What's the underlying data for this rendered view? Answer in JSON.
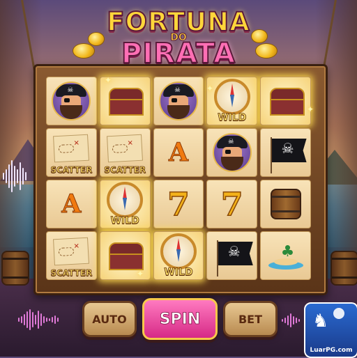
{
  "game": {
    "title_line1": "FORTUNA",
    "title_do": "DO",
    "title_line2": "PIRATA"
  },
  "reels": [
    [
      {
        "symbol": "pirate-captain-icon",
        "label": "",
        "win": false
      },
      {
        "symbol": "treasure-map-icon",
        "label": "SCATTER",
        "win": false
      },
      {
        "symbol": "letter-a",
        "label": "A",
        "win": false
      },
      {
        "symbol": "treasure-map-icon",
        "label": "SCATTER",
        "win": false
      }
    ],
    [
      {
        "symbol": "treasure-chest-icon",
        "label": "",
        "win": true
      },
      {
        "symbol": "treasure-map-icon",
        "label": "SCATTER",
        "win": false
      },
      {
        "symbol": "compass-icon",
        "label": "WILD",
        "win": true
      },
      {
        "symbol": "treasure-chest-icon",
        "label": "",
        "win": true
      }
    ],
    [
      {
        "symbol": "pirate-captain-icon",
        "label": "",
        "win": false
      },
      {
        "symbol": "letter-a",
        "label": "A",
        "win": false
      },
      {
        "symbol": "lucky-seven",
        "label": "7",
        "win": false
      },
      {
        "symbol": "compass-icon",
        "label": "WILD",
        "win": true
      }
    ],
    [
      {
        "symbol": "compass-icon",
        "label": "WILD",
        "win": true
      },
      {
        "symbol": "pirate-captain-icon",
        "label": "",
        "win": false
      },
      {
        "symbol": "lucky-seven",
        "label": "7",
        "win": false
      },
      {
        "symbol": "pirate-flag-icon",
        "label": "",
        "win": false
      }
    ],
    [
      {
        "symbol": "treasure-chest-icon",
        "label": "",
        "win": true
      },
      {
        "symbol": "pirate-flag-icon",
        "label": "",
        "win": false
      },
      {
        "symbol": "rum-barrel-icon",
        "label": "",
        "win": false
      },
      {
        "symbol": "palm-island-icon",
        "label": "",
        "win": false
      }
    ]
  ],
  "controls": {
    "auto_label": "AUTO",
    "spin_label": "SPIN",
    "bet_label": "BET"
  },
  "branding": {
    "logo_text": "LuarPG.com"
  },
  "colors": {
    "spin_button": "#e0409a",
    "title_gold": "#ffd63a",
    "title_pink": "#ff6fb5",
    "reel_frame": "#8a5a30"
  }
}
